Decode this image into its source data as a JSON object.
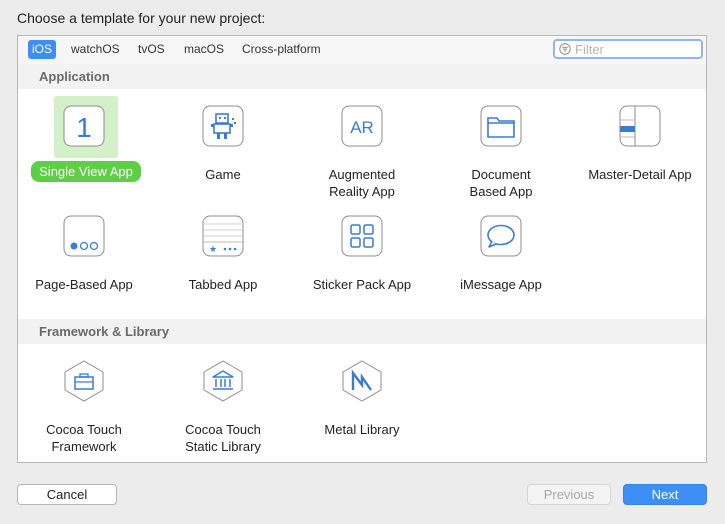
{
  "dialog": {
    "title": "Choose a template for your new project:"
  },
  "platform_tabs": [
    "iOS",
    "watchOS",
    "tvOS",
    "macOS",
    "Cross-platform"
  ],
  "selected_tab": "iOS",
  "filter": {
    "placeholder": "Filter",
    "value": ""
  },
  "sections": [
    {
      "title": "Application",
      "templates": [
        {
          "label": "Single View App",
          "icon": "single-view-icon",
          "selected": true
        },
        {
          "label": "Game",
          "icon": "game-icon"
        },
        {
          "label": "Augmented\nReality App",
          "icon": "ar-icon"
        },
        {
          "label": "Document\nBased App",
          "icon": "document-folder-icon"
        },
        {
          "label": "Master-Detail App",
          "icon": "master-detail-icon"
        },
        {
          "label": "Page-Based App",
          "icon": "page-based-icon"
        },
        {
          "label": "Tabbed App",
          "icon": "tabbed-icon"
        },
        {
          "label": "Sticker Pack App",
          "icon": "sticker-pack-icon"
        },
        {
          "label": "iMessage App",
          "icon": "imessage-icon"
        }
      ]
    },
    {
      "title": "Framework & Library",
      "templates": [
        {
          "label": "Cocoa Touch\nFramework",
          "icon": "toolbox-icon"
        },
        {
          "label": "Cocoa Touch\nStatic Library",
          "icon": "library-building-icon"
        },
        {
          "label": "Metal Library",
          "icon": "metal-icon"
        }
      ]
    }
  ],
  "buttons": {
    "cancel": "Cancel",
    "previous": "Previous",
    "next": "Next"
  },
  "colors": {
    "accent": "#3d8ef5",
    "selection": "#5fce47",
    "icon_blue": "#3a7bd5"
  }
}
